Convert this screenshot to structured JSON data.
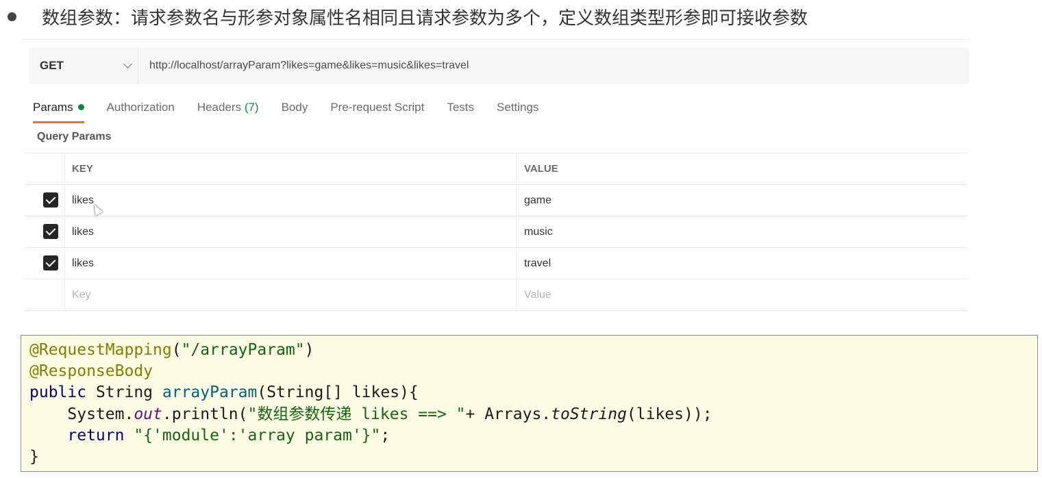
{
  "heading": {
    "text": "数组参数：请求参数名与形参对象属性名相同且请求参数为多个，定义数组类型形参即可接收参数"
  },
  "request": {
    "method": "GET",
    "url": "http://localhost/arrayParam?likes=game&likes=music&likes=travel"
  },
  "tabs": [
    {
      "label": "Params",
      "active": true,
      "indicator": "green-dot"
    },
    {
      "label": "Authorization"
    },
    {
      "label": "Headers",
      "count": "(7)"
    },
    {
      "label": "Body"
    },
    {
      "label": "Pre-request Script"
    },
    {
      "label": "Tests"
    },
    {
      "label": "Settings"
    }
  ],
  "query_params": {
    "title": "Query Params",
    "columns": {
      "key": "KEY",
      "value": "VALUE"
    },
    "rows": [
      {
        "checked": true,
        "key": "likes",
        "value": "game"
      },
      {
        "checked": true,
        "key": "likes",
        "value": "music"
      },
      {
        "checked": true,
        "key": "likes",
        "value": "travel"
      }
    ],
    "placeholder": {
      "key": "Key",
      "value": "Value"
    }
  },
  "code": {
    "l1_anno": "@RequestMapping",
    "l1_open": "(",
    "l1_str": "\"/arrayParam\"",
    "l1_close": ")",
    "l2_anno": "@ResponseBody",
    "l3_kw": "public",
    "l3_type": " String ",
    "l3_fn": "arrayParam",
    "l3_rest": "(String[] likes){",
    "l4_indent": "    System.",
    "l4_field": "out",
    "l4_call": ".println(",
    "l4_str": "\"数组参数传递 likes ==> \"",
    "l4_mid": "+ Arrays.",
    "l4_it": "toString",
    "l4_end": "(likes));",
    "l5_indent": "    ",
    "l5_kw": "return",
    "l5_sp": " ",
    "l5_str": "\"{'module':'array param'}\"",
    "l5_end": ";",
    "l6": "}"
  },
  "colors": {
    "accent_tab": "#f26b3a",
    "status_green": "#0d8a3a",
    "code_bg": "#fdfde6"
  }
}
